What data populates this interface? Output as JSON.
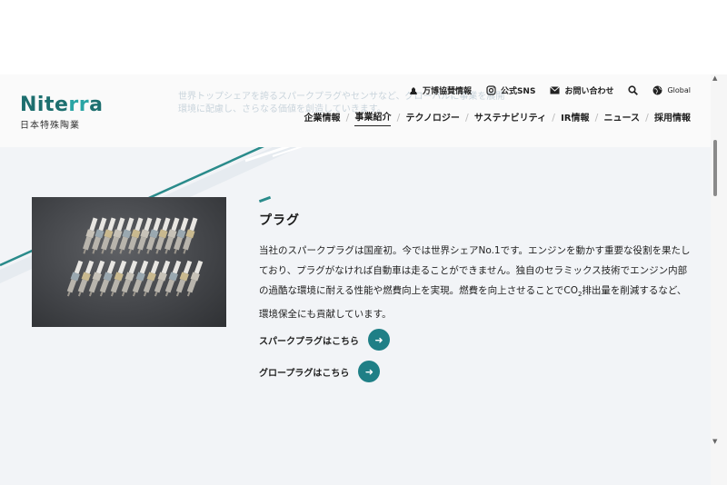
{
  "brand": {
    "name_a": "Niterra",
    "name_ja": "日本特殊陶業"
  },
  "header_bg_text": {
    "line1": "世界トップシェアを誇るスパークプラグやセンサなど、グローバルに事業を展開",
    "line2": "環境に配慮し、さらなる価値を創造していきます。"
  },
  "utility_nav": [
    {
      "label": "万博協賛情報",
      "icon": "expo-icon"
    },
    {
      "label": "公式SNS",
      "icon": "instagram-icon"
    },
    {
      "label": "お問い合わせ",
      "icon": "mail-icon"
    },
    {
      "label": "",
      "icon": "search-icon"
    },
    {
      "label": "Global",
      "icon": "globe-icon"
    }
  ],
  "main_nav": [
    "企業情報",
    "事業紹介",
    "テクノロジー",
    "サステナビリティ",
    "IR情報",
    "ニュース",
    "採用情報"
  ],
  "main_nav_active": "事業紹介",
  "section": {
    "title": "プラグ",
    "desc_1": "当社のスパークプラグは国産初。今では世界シェアNo.1です。エンジンを動かす重要な役割を果たしており、プラグがなければ自動車は走ることができません。独自のセラミックス技術でエンジン内部の過酷な環境に耐える性能や燃費向上を実現。燃費を向上させることでCO",
    "desc_sub": "2",
    "desc_2": "排出量を削減するなど、環境保全にも貢献しています。",
    "links": [
      {
        "label": "スパークプラグはこちら"
      },
      {
        "label": "グロープラグはこちら"
      }
    ]
  },
  "colors": {
    "brand_teal": "#1d6f6f",
    "button_teal": "#1f7f86",
    "content_bg": "#f2f4f7"
  },
  "image": {
    "alt": "spark plugs product photo"
  }
}
